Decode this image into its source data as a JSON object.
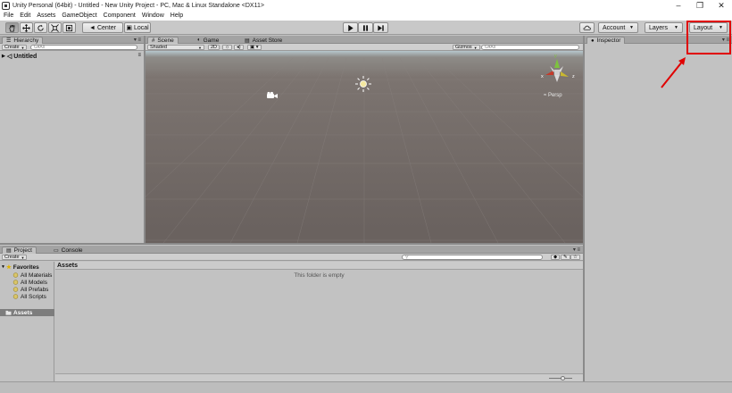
{
  "window": {
    "title": "Unity Personal (64bit) - Untitled - New Unity Project - PC, Mac & Linux Standalone <DX11>",
    "controls": [
      "–",
      "❐",
      "✕"
    ]
  },
  "menu": [
    "File",
    "Edit",
    "Assets",
    "GameObject",
    "Component",
    "Window",
    "Help"
  ],
  "toolbar": {
    "tools": [
      "hand-tool",
      "move-tool",
      "rotate-tool",
      "scale-tool",
      "rect-tool"
    ],
    "pivot_label": "Center",
    "space_label": "Local",
    "play_controls": [
      "play",
      "pause",
      "step"
    ],
    "account_label": "Account",
    "layers_label": "Layers",
    "layout_label": "Layout"
  },
  "hierarchy": {
    "tab_label": "Hierarchy",
    "create_label": "Create",
    "search_placeholder": "G▾All",
    "scene_name": "Untitled"
  },
  "scene": {
    "tabs": [
      {
        "label": "Scene",
        "icon": "#"
      },
      {
        "label": "Game",
        "icon": "◐"
      },
      {
        "label": "Asset Store",
        "icon": "▤"
      }
    ],
    "shading_label": "Shaded",
    "mode_2d": "2D",
    "gizmos_label": "Gizmos",
    "search_placeholder": "G▾All",
    "persp_label": "≈ Persp",
    "gizmo_axis_y": "y",
    "gizmo_axis_x": "x",
    "gizmo_axis_z": "z"
  },
  "inspector": {
    "tab_label": "Inspector"
  },
  "project": {
    "tabs": [
      {
        "label": "Project",
        "icon": "▤"
      },
      {
        "label": "Console",
        "icon": "▭"
      }
    ],
    "create_label": "Create",
    "favorites_label": "Favorites",
    "favorites": [
      "All Materials",
      "All Models",
      "All Prefabs",
      "All Scripts"
    ],
    "assets_label": "Assets",
    "breadcrumb": "Assets",
    "empty_message": "This folder is empty"
  },
  "colors": {
    "highlight": "#e00000"
  }
}
